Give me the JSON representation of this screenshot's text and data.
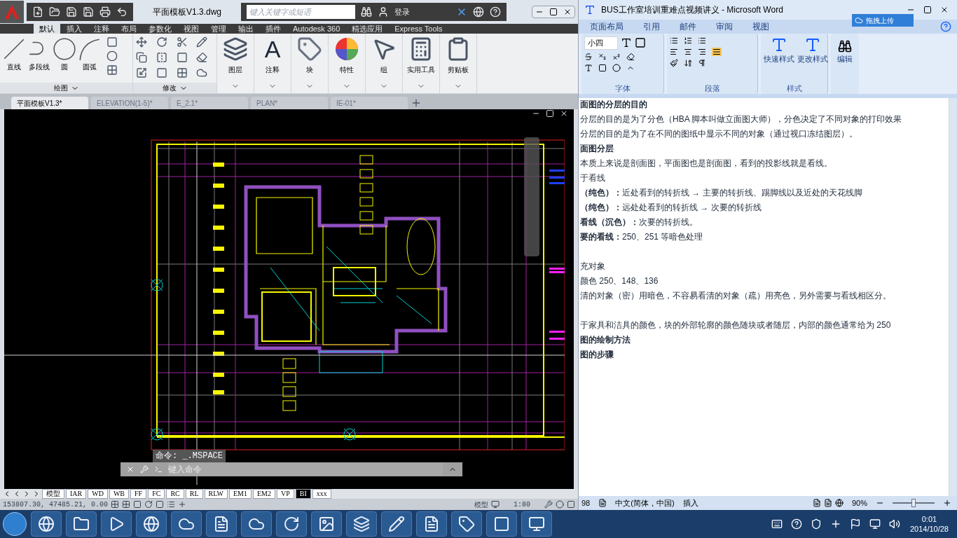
{
  "cad": {
    "title": "平面模板V1.3.dwg",
    "search": {
      "placeholder": "键入关键字或短语"
    },
    "login": "登录",
    "ribbon_tabs": [
      {
        "label": "默认",
        "selected": true
      },
      {
        "label": "插入",
        "selected": false
      },
      {
        "label": "注释",
        "selected": false
      },
      {
        "label": "布局",
        "selected": false
      },
      {
        "label": "参数化",
        "selected": false
      },
      {
        "label": "视图",
        "selected": false
      },
      {
        "label": "管理",
        "selected": false
      },
      {
        "label": "输出",
        "selected": false
      },
      {
        "label": "插件",
        "selected": false
      },
      {
        "label": "Autodesk 360",
        "selected": false
      },
      {
        "label": "精选应用",
        "selected": false
      },
      {
        "label": "Express Tools",
        "selected": false
      }
    ],
    "draw_tools": [
      {
        "label": "直线",
        "kind": "line"
      },
      {
        "label": "多段线",
        "kind": "polyline"
      },
      {
        "label": "圆",
        "kind": "circle"
      },
      {
        "label": "圆弧",
        "kind": "arc"
      }
    ],
    "panel_labels": [
      "绘图",
      "修改"
    ],
    "big_tools": [
      {
        "label": "图层",
        "kind": "layers"
      },
      {
        "label": "注释",
        "kind": "letter",
        "glyph": "A"
      },
      {
        "label": "块",
        "kind": "block"
      },
      {
        "label": "特性",
        "kind": "wheel"
      },
      {
        "label": "组",
        "kind": "group"
      },
      {
        "label": "实用工具",
        "kind": "calculator"
      },
      {
        "label": "剪贴板",
        "kind": "clipboard"
      }
    ],
    "doc_tabs": [
      {
        "label": "平面模板V1.3*",
        "selected": true
      },
      {
        "label": "ELEVATION(1-5)*",
        "selected": false
      },
      {
        "label": "E_2.1*",
        "selected": false
      },
      {
        "label": "PLAN*",
        "selected": false
      },
      {
        "label": "IE-01*",
        "selected": false
      }
    ],
    "command_history": "命令: _.MSPACE",
    "command": {
      "placeholder": "键入命令"
    },
    "layout_tabs": [
      {
        "label": "模型",
        "selected": false
      },
      {
        "label": "IAR",
        "selected": false
      },
      {
        "label": "WD",
        "selected": false
      },
      {
        "label": "WB",
        "selected": false
      },
      {
        "label": "FF",
        "selected": false
      },
      {
        "label": "FC",
        "selected": false
      },
      {
        "label": "RC",
        "selected": false
      },
      {
        "label": "RL",
        "selected": false
      },
      {
        "label": "RLW",
        "selected": false
      },
      {
        "label": "EM1",
        "selected": false
      },
      {
        "label": "EM2",
        "selected": false
      },
      {
        "label": "VP",
        "selected": false
      },
      {
        "label": "BI",
        "selected": true
      },
      {
        "label": "xxx",
        "selected": false
      }
    ],
    "coordinates": "153807.30, 47485.21, 0.00",
    "space": "模型",
    "scale": "1:80"
  },
  "word": {
    "title": "BUS工作室培训重难点视频讲义 - Microsoft Word",
    "upload": "拖拽上传",
    "tabs": [
      "页面布局",
      "引用",
      "邮件",
      "审阅",
      "视图"
    ],
    "font_size": "小四",
    "groups": [
      "字体",
      "段落",
      "样式"
    ],
    "styles": [
      "快速样式",
      "更改样式"
    ],
    "edit": "编辑",
    "sections": [
      [
        {
          "text": "面图的分层的目的",
          "bold": true
        },
        {
          "text": "分层的目的是为了分色（HBA 脚本叫做立面图大师），分色决定了不同对象的打印效果",
          "bold": false
        },
        {
          "text": "分层的目的是为了在不同的图纸中显示不同的对象（通过视口冻结图层）。",
          "bold": false
        },
        {
          "text": "面图分层",
          "bold": true
        },
        {
          "text": "本质上来说是剖面图，平面图也是剖面图，看到的投影线就是看线。",
          "bold": false
        },
        {
          "text": "于看线",
          "bold": false
        },
        {
          "text": "**（纯色）：**近处看到的转折线 → 主要的转折线、踢脚线以及近处的天花线脚",
          "bold": false
        },
        {
          "text": "**（纯色）：**远处处看到的转折线 → 次要的转折线",
          "bold": false
        },
        {
          "text": "**看线（沉色）：**次要的转折线。",
          "bold": false
        },
        {
          "text": "**要的看线：**250、251 等暗色处理",
          "bold": false
        }
      ],
      [
        {
          "text": "充对象",
          "bold": false
        },
        {
          "text": "颜色 250、148、136",
          "bold": false
        },
        {
          "text": "清的对象（密）用暗色，不容易看清的对象（疏）用亮色，另外需要与看线相区分。",
          "bold": false
        }
      ],
      [
        {
          "text": "于家具和洁具的颜色，块的外部轮廓的颜色随块或者随层，内部的颜色通常给为 250",
          "bold": false
        },
        {
          "text": "图的绘制方法",
          "bold": true
        },
        {
          "text": "图的步骤",
          "bold": true
        }
      ]
    ],
    "page": "98",
    "language": "中文(简体，中国)",
    "mode": "插入",
    "zoom": "90%",
    "zoom_slider": {
      "level": 0.5
    }
  },
  "taskbar": {
    "time": "0:01",
    "date": "2014/10/28"
  }
}
